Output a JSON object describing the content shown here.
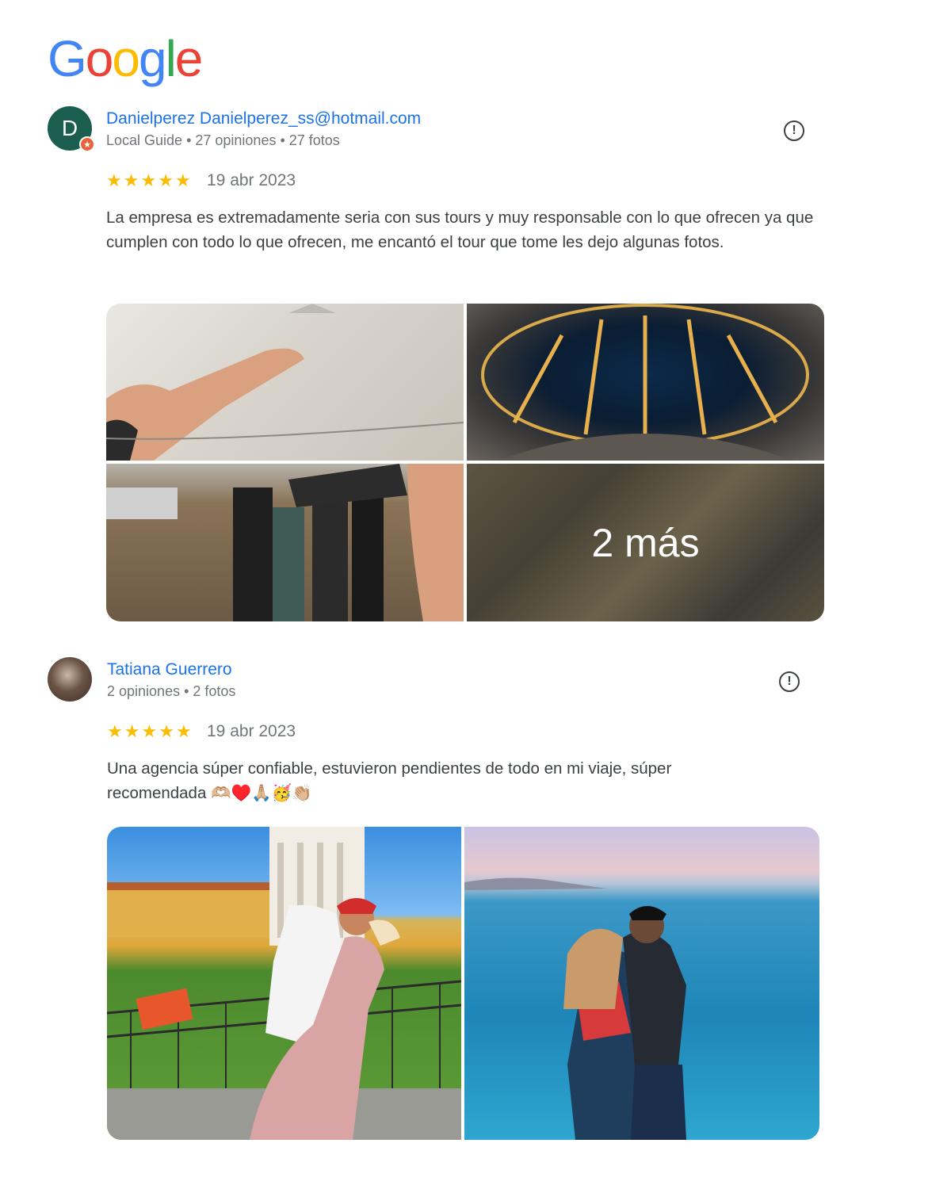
{
  "logo": {
    "text": "Google",
    "colors": [
      "#4285F4",
      "#EA4335",
      "#FBBC05",
      "#4285F4",
      "#34A853",
      "#EA4335"
    ]
  },
  "reviews": [
    {
      "author": "Danielperez Danielperez_ss@hotmail.com",
      "avatar_letter": "D",
      "avatar_color": "#1b5e4f",
      "meta": "Local Guide • 27 opiniones • 27 fotos",
      "rating": 5,
      "date": "19 abr 2023",
      "text": "La empresa es extremadamente seria con sus tours y muy responsable con lo que ofrecen ya que cumplen con todo lo que ofrecen, me encantó el tour que tome les dejo algunas fotos.",
      "more_label": "2 más"
    },
    {
      "author": "Tatiana Guerrero",
      "meta": "2 opiniones • 2 fotos",
      "rating": 5,
      "date": "19 abr 2023",
      "text": "Una agencia súper confiable, estuvieron pendientes de todo en mi viaje, súper recomendada 🫶🏼♥️🙏🏼🥳👏🏼"
    }
  ]
}
